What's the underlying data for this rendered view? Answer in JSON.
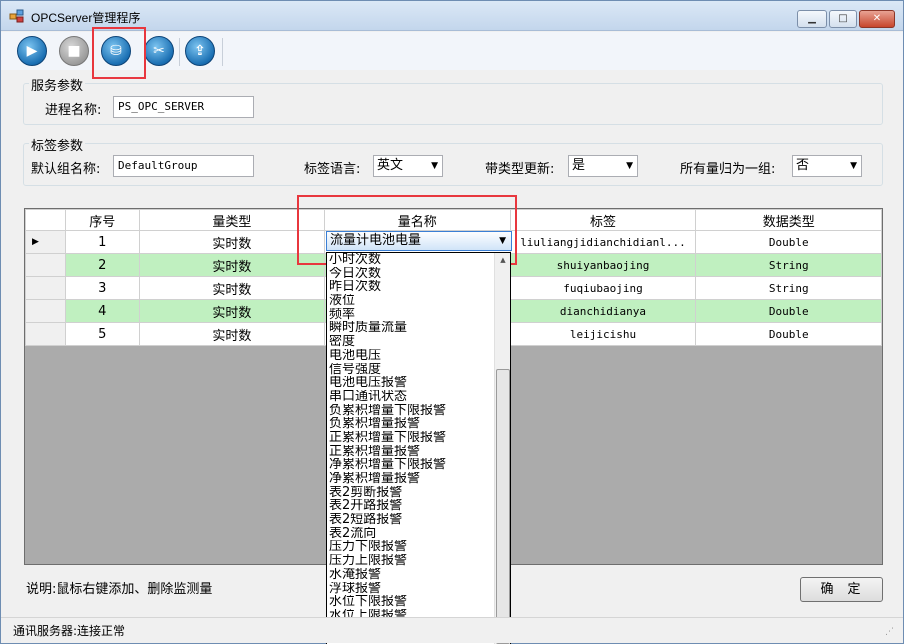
{
  "window": {
    "title": "OPCServer管理程序",
    "controls": {
      "minimize": "▁",
      "maximize": "□",
      "close": "✕"
    }
  },
  "toolbar": {
    "buttons": [
      {
        "name": "start-icon",
        "glyph": "▶",
        "enabled": true
      },
      {
        "name": "stop-icon",
        "glyph": "■",
        "enabled": false
      },
      {
        "name": "network-icon",
        "glyph": "⛁",
        "enabled": true,
        "highlighted": true
      },
      {
        "name": "tools-icon",
        "glyph": "✂",
        "enabled": true
      },
      {
        "name": "export-icon",
        "glyph": "⇪",
        "enabled": true
      }
    ]
  },
  "service": {
    "group_title": "服务参数",
    "process_label": "进程名称:",
    "process_value": "PS_OPC_SERVER"
  },
  "tag": {
    "group_title": "标签参数",
    "default_group_label": "默认组名称:",
    "default_group_value": "DefaultGroup",
    "language_label": "标签语言:",
    "language_value": "英文",
    "type_update_label": "带类型更新:",
    "type_update_value": "是",
    "single_group_label": "所有量归为一组:",
    "single_group_value": "否"
  },
  "grid": {
    "headers": [
      "序号",
      "量类型",
      "量名称",
      "标签",
      "数据类型"
    ],
    "rows": [
      {
        "no": "1",
        "kind": "实时数",
        "name": "流量计电池电量",
        "tag": "liuliangjidianchidianl...",
        "dtype": "Double"
      },
      {
        "no": "2",
        "kind": "实时数",
        "name": "",
        "tag": "shuiyanbaojing",
        "dtype": "String"
      },
      {
        "no": "3",
        "kind": "实时数",
        "name": "",
        "tag": "fuqiubaojing",
        "dtype": "String"
      },
      {
        "no": "4",
        "kind": "实时数",
        "name": "",
        "tag": "dianchidianya",
        "dtype": "Double"
      },
      {
        "no": "5",
        "kind": "实时数",
        "name": "",
        "tag": "leijicishu",
        "dtype": "Double"
      }
    ]
  },
  "dropdown": {
    "selected": "流量计电池电量",
    "items": [
      "小时次数",
      "今日次数",
      "昨日次数",
      "液位",
      "频率",
      "瞬时质量流量",
      "密度",
      "电池电压",
      "信号强度",
      "电池电压报警",
      "串口通讯状态",
      "负累积增量下限报警",
      "负累积增量报警",
      "正累积增量下限报警",
      "正累积增量报警",
      "净累积增量下限报警",
      "净累积增量报警",
      "表2剪断报警",
      "表2开路报警",
      "表2短路报警",
      "表2流向",
      "压力下限报警",
      "压力上限报警",
      "水淹报警",
      "浮球报警",
      "水位下限报警",
      "水位上限报警",
      "流量计电池电量"
    ]
  },
  "footer": {
    "hint": "说明:鼠标右键添加、删除监测量",
    "ok_label": "确定",
    "status": "通讯服务器:连接正常"
  },
  "colors": {
    "alt_row": "#c0f0c0",
    "highlight_box": "#e8373e",
    "selection": "#3399ff"
  }
}
